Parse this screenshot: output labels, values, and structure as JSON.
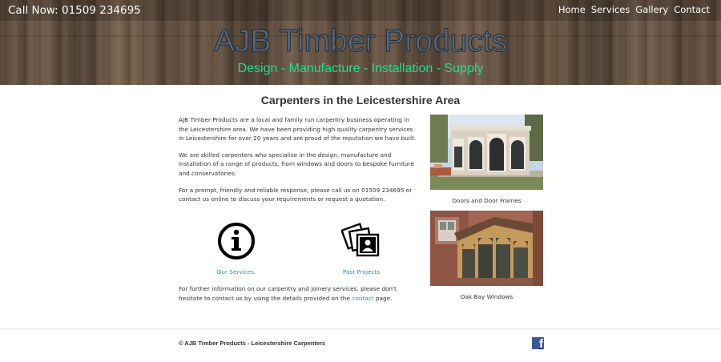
{
  "header": {
    "call": "Call Now: 01509 234695",
    "nav": [
      "Home",
      "Services",
      "Gallery",
      "Contact"
    ],
    "brand": "AJB Timber Products",
    "tagline": "Design - Manufacture - Installation - Supply"
  },
  "main": {
    "title": "Carpenters in the Leicestershire Area",
    "paragraphs": [
      "AJB Timber Products are a local and family run carpentry business operating in the Leicestershire area. We have been providing high quality carpentry services in Leicestershire for over 20 years and are proud of the reputation we have built.",
      "We are skilled carpenters who specialise in the design, manufacture and installation of a range of products, from windows and doors to bespoke furniture and conservatories.",
      "For a prompt, friendly and reliable response, please call us on 01509 234695 or contact us online to discuss your requirements or request a quotation."
    ],
    "features": [
      {
        "label": "Our Services.",
        "icon": "info-icon"
      },
      {
        "label": "Past Projects",
        "icon": "photos-icon"
      }
    ],
    "closing_before": "For further information on our carpentry and joinery services, please don't hesitate to contact us by using the details provided on the ",
    "closing_link": "contact",
    "closing_after": " page."
  },
  "gallery": [
    {
      "caption": "Doors and Door Frames"
    },
    {
      "caption": "Oak Bay Windows"
    }
  ],
  "footer": {
    "copyright": "© AJB Timber Products - Leicestershire Carpenters",
    "social_icon": "facebook-icon"
  },
  "colors": {
    "brand_text": "#556a80",
    "tagline": "#22e08a",
    "link": "#2a8fc8",
    "facebook": "#3b5998"
  }
}
